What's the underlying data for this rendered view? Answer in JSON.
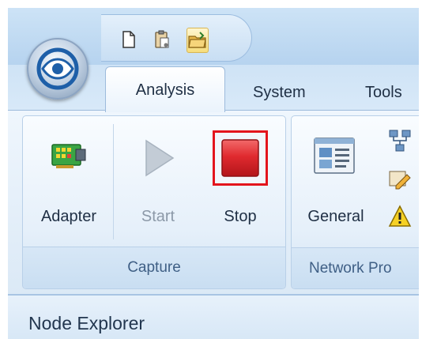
{
  "tabs": [
    {
      "label": "Analysis",
      "selected": true
    },
    {
      "label": "System",
      "selected": false
    },
    {
      "label": "Tools",
      "selected": false
    }
  ],
  "ribbon": {
    "capture_group": {
      "label": "Capture",
      "buttons": [
        {
          "label": "Adapter",
          "icon": "adapter-icon",
          "enabled": true
        },
        {
          "label": "Start",
          "icon": "play-icon",
          "enabled": false
        },
        {
          "label": "Stop",
          "icon": "stop-icon",
          "enabled": true,
          "highlighted": true
        }
      ]
    },
    "network_group": {
      "label": "Network Pro",
      "buttons": [
        {
          "label": "General",
          "icon": "general-icon"
        }
      ],
      "small_icons": [
        "network-icon",
        "edit-icon",
        "warning-icon"
      ]
    }
  },
  "quick_access": [
    "new-icon",
    "clipboard-icon",
    "open-folder-icon"
  ],
  "pane": {
    "title": "Node Explorer"
  },
  "colors": {
    "stop_red": "#d9252b",
    "highlight_border": "#e3141c",
    "accent_blue": "#3f5f85"
  }
}
